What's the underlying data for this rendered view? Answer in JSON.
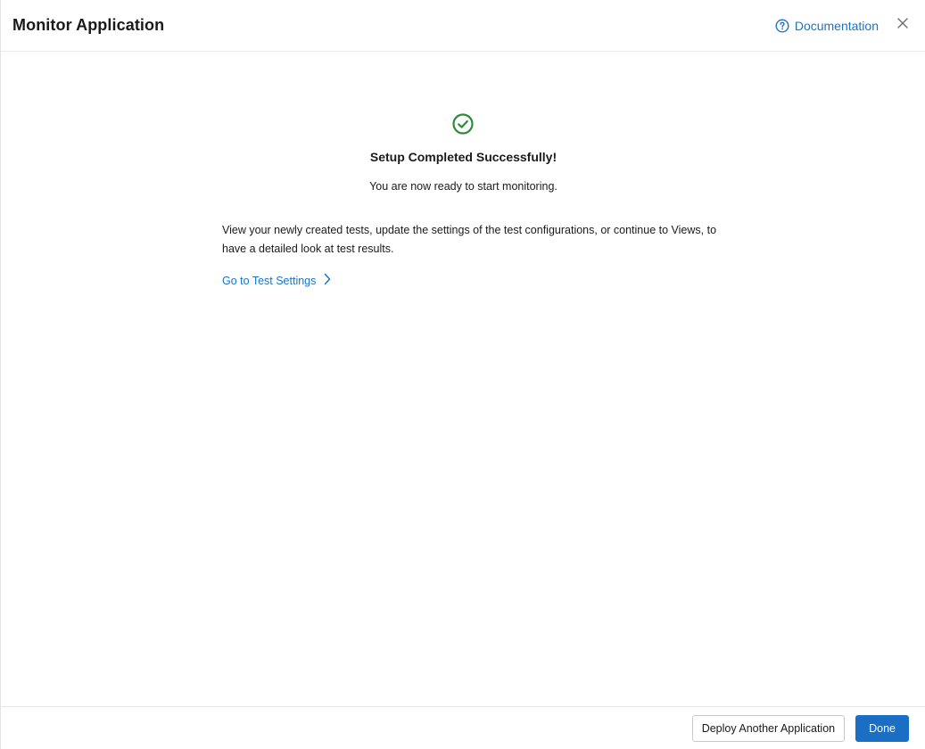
{
  "header": {
    "title": "Monitor Application",
    "documentation_label": "Documentation",
    "help_icon": "question-circle-icon",
    "close_icon": "close-icon"
  },
  "content": {
    "status_icon": "check-circle-icon",
    "title": "Setup Completed Successfully!",
    "subtitle": "You are now ready to start monitoring.",
    "description": "View your newly created tests, update the settings of the test configurations, or continue to Views, to have a detailed look at test results.",
    "link_label": "Go to Test Settings",
    "link_icon": "chevron-right-icon"
  },
  "footer": {
    "secondary_label": "Deploy Another Application",
    "primary_label": "Done"
  },
  "colors": {
    "accent": "#1a73c8",
    "primary_button": "#1a6fc4",
    "success": "#2e8b3a",
    "text": "#1a1a1a"
  }
}
